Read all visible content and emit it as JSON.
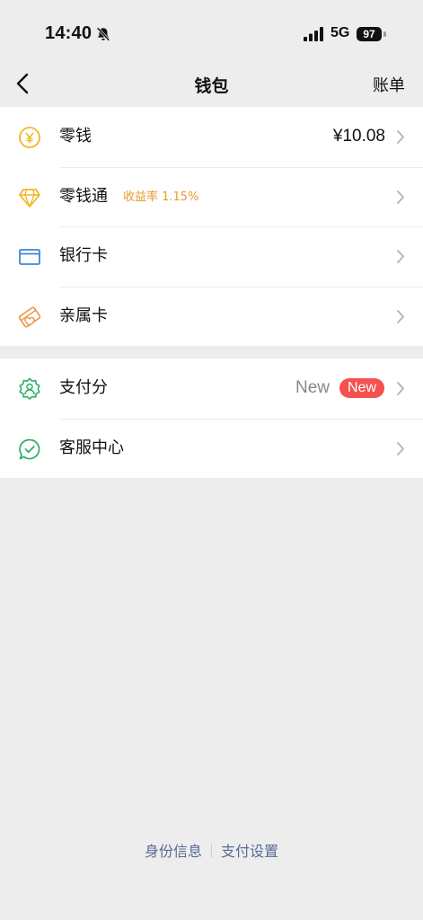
{
  "status_bar": {
    "time": "14:40",
    "network": "5G",
    "battery": "97"
  },
  "nav": {
    "title": "钱包",
    "bill": "账单"
  },
  "groups": [
    [
      {
        "label": "零钱",
        "value": "¥10.08",
        "icon": "yuan-coin-icon",
        "color": "#f0b621"
      },
      {
        "label": "零钱通",
        "tag": "收益率 1.15%",
        "icon": "diamond-icon",
        "color": "#f0b621"
      },
      {
        "label": "银行卡",
        "icon": "bank-card-icon",
        "color": "#3e86d6"
      },
      {
        "label": "亲属卡",
        "icon": "family-card-icon",
        "color": "#ee9a4a"
      }
    ],
    [
      {
        "label": "支付分",
        "new_text": "New",
        "badge": "New",
        "icon": "pay-score-icon",
        "color": "#2aae67"
      },
      {
        "label": "客服中心",
        "icon": "customer-service-icon",
        "color": "#2aae67"
      }
    ]
  ],
  "footer": {
    "identity": "身份信息",
    "settings": "支付设置"
  },
  "colors": {
    "badge": "#f55150",
    "link": "#576b95",
    "tag": "#e89a2c",
    "background": "#ededed"
  }
}
